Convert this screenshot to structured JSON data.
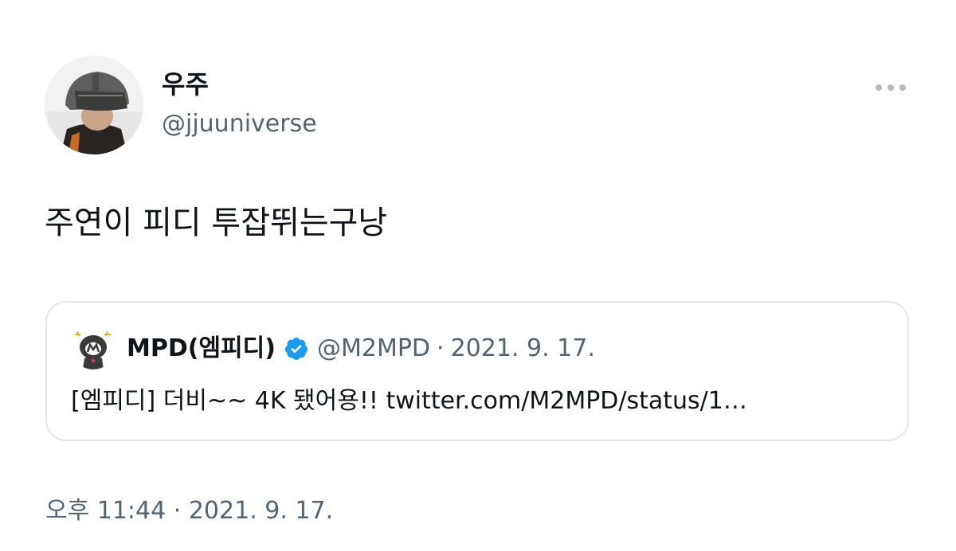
{
  "tweet": {
    "author": {
      "display_name": "우주",
      "handle": "@jjuuniverse",
      "avatar": "profile-photo"
    },
    "more_icon": "more-dots-icon",
    "text": "주연이 피디 투잡뛰는구낭",
    "quoted": {
      "display_name": "MPD(엠피디)",
      "verified_icon": "verified-badge-icon",
      "handle": "@M2MPD",
      "separator": "·",
      "date": "2021. 9. 17.",
      "text": "[엠피디] 더비~~ 4K 됐어용!! twitter.com/M2MPD/status/1…"
    },
    "time": "오후 11:44",
    "time_separator": "·",
    "date": "2021. 9. 17."
  },
  "colors": {
    "text_primary": "#0f1419",
    "text_secondary": "#536471",
    "border": "#e3e7ea",
    "verified_blue": "#1d9bf0"
  }
}
